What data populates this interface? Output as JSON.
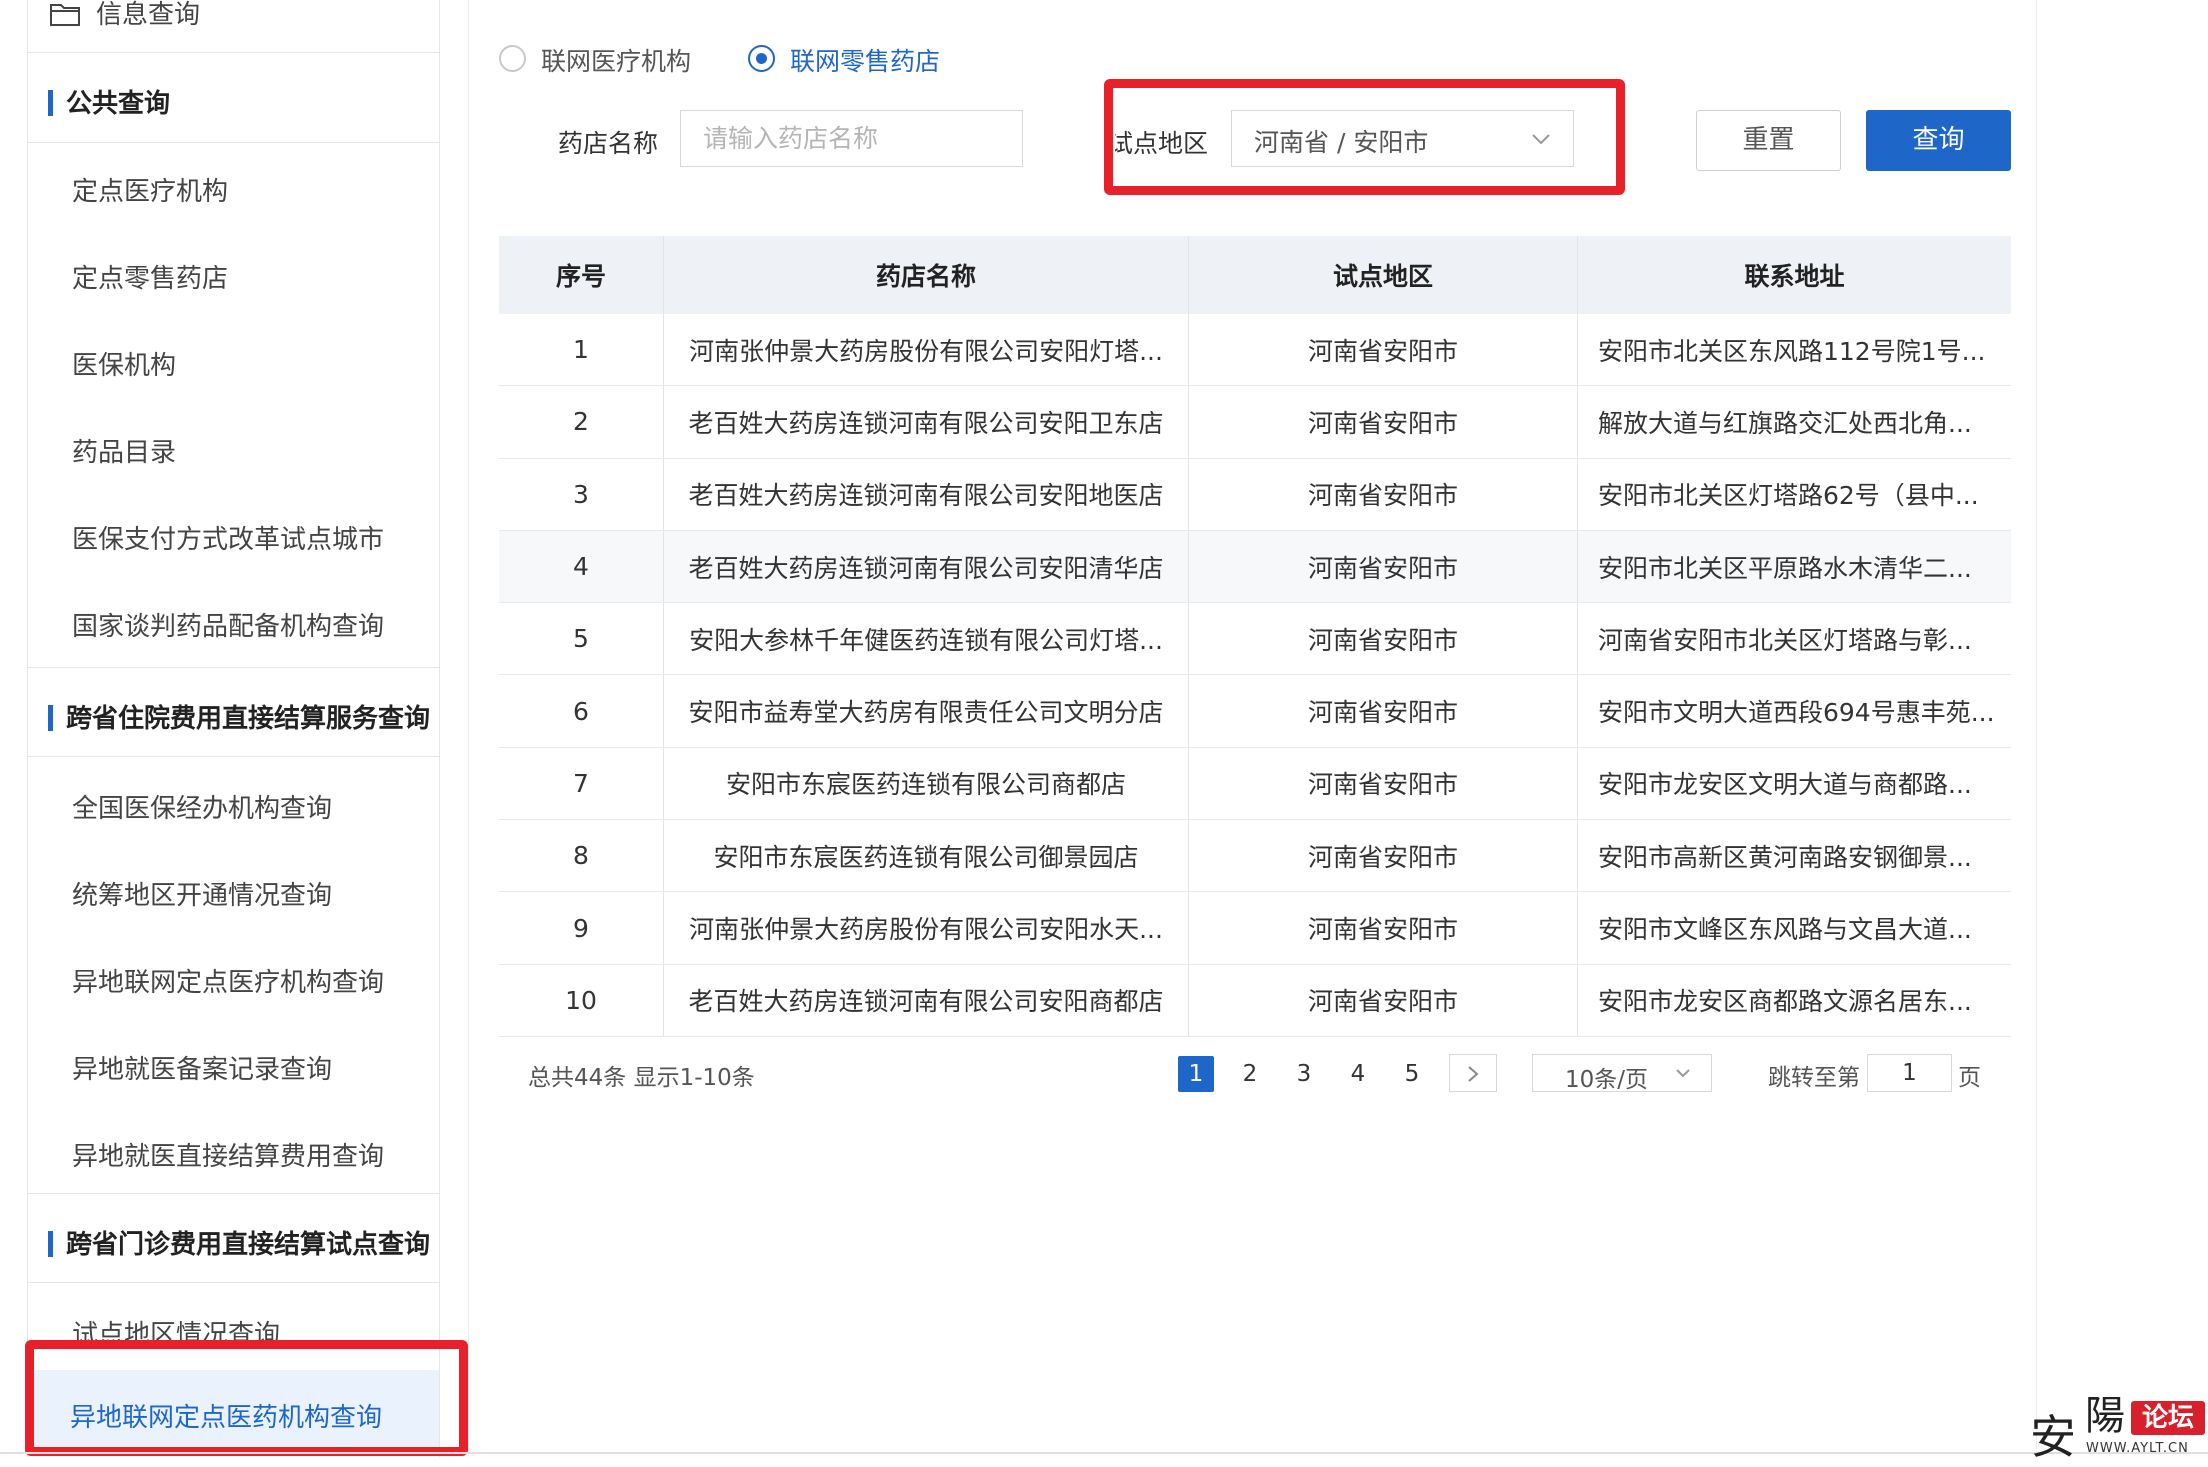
{
  "sidebar": {
    "top_label": "信息查询",
    "sections": [
      {
        "title": "公共查询",
        "items": [
          "定点医疗机构",
          "定点零售药店",
          "医保机构",
          "药品目录",
          "医保支付方式改革试点城市",
          "国家谈判药品配备机构查询"
        ]
      },
      {
        "title": "跨省住院费用直接结算服务查询",
        "items": [
          "全国医保经办机构查询",
          "统筹地区开通情况查询",
          "异地联网定点医疗机构查询",
          "异地就医备案记录查询",
          "异地就医直接结算费用查询"
        ]
      },
      {
        "title": "跨省门诊费用直接结算试点查询",
        "items": [
          "试点地区情况查询",
          "异地联网定点医药机构查询"
        ]
      }
    ],
    "active_item": "异地联网定点医药机构查询"
  },
  "radios": [
    {
      "label": "联网医疗机构",
      "checked": false
    },
    {
      "label": "联网零售药店",
      "checked": true
    }
  ],
  "filters": {
    "name_label": "药店名称",
    "name_placeholder": "请输入药店名称",
    "region_label": "试点地区",
    "region_value": "河南省 / 安阳市",
    "reset_label": "重置",
    "search_label": "查询"
  },
  "table": {
    "headers": [
      "序号",
      "药店名称",
      "试点地区",
      "联系地址"
    ],
    "rows": [
      [
        "1",
        "河南张仲景大药房股份有限公司安阳灯塔...",
        "河南省安阳市",
        "安阳市北关区东风路112号院1号..."
      ],
      [
        "2",
        "老百姓大药房连锁河南有限公司安阳卫东店",
        "河南省安阳市",
        "解放大道与红旗路交汇处西北角..."
      ],
      [
        "3",
        "老百姓大药房连锁河南有限公司安阳地医店",
        "河南省安阳市",
        "安阳市北关区灯塔路62号（县中..."
      ],
      [
        "4",
        "老百姓大药房连锁河南有限公司安阳清华店",
        "河南省安阳市",
        "安阳市北关区平原路水木清华二..."
      ],
      [
        "5",
        "安阳大参林千年健医药连锁有限公司灯塔...",
        "河南省安阳市",
        "河南省安阳市北关区灯塔路与彰..."
      ],
      [
        "6",
        "安阳市益寿堂大药房有限责任公司文明分店",
        "河南省安阳市",
        "安阳市文明大道西段694号惠丰苑..."
      ],
      [
        "7",
        "安阳市东宸医药连锁有限公司商都店",
        "河南省安阳市",
        "安阳市龙安区文明大道与商都路..."
      ],
      [
        "8",
        "安阳市东宸医药连锁有限公司御景园店",
        "河南省安阳市",
        "安阳市高新区黄河南路安钢御景..."
      ],
      [
        "9",
        "河南张仲景大药房股份有限公司安阳水天...",
        "河南省安阳市",
        "安阳市文峰区东风路与文昌大道..."
      ],
      [
        "10",
        "老百姓大药房连锁河南有限公司安阳商都店",
        "河南省安阳市",
        "安阳市龙安区商都路文源名居东..."
      ]
    ]
  },
  "pagination": {
    "total_text": "总共44条  显示1-10条",
    "pages": [
      "1",
      "2",
      "3",
      "4",
      "5"
    ],
    "current": "1",
    "page_size": "10条/页",
    "jump_prefix": "跳转至第",
    "jump_value": "1",
    "jump_suffix": "页"
  },
  "watermark": {
    "char1": "安",
    "char2": "陽",
    "badge": "论坛",
    "url": "WWW.AYLT.CN"
  },
  "colors": {
    "accent": "#1e66c8",
    "highlight": "#e8202a",
    "header_bg": "#eef1f5"
  }
}
